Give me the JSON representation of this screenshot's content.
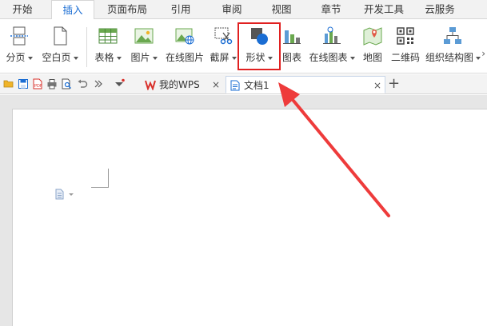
{
  "menu_tabs": [
    "开始",
    "插入",
    "页面布局",
    "引用",
    "审阅",
    "视图",
    "章节",
    "开发工具",
    "云服务"
  ],
  "active_menu_tab": "插入",
  "ribbon": {
    "page_break": "分页",
    "blank_page": "空白页",
    "table": "表格",
    "picture": "图片",
    "online_picture": "在线图片",
    "screenshot": "截屏",
    "shape": "形状",
    "chart": "图表",
    "online_chart": "在线图表",
    "map": "地图",
    "qr_code": "二维码",
    "org_chart": "组织结构图",
    "more": "›"
  },
  "tabs": {
    "wps": "我的WPS",
    "doc": "文档1",
    "close": "×",
    "new": "+"
  },
  "colors": {
    "accent_blue": "#1a6dd3",
    "highlight_red": "#e02020",
    "wps_red": "#d9302b"
  }
}
